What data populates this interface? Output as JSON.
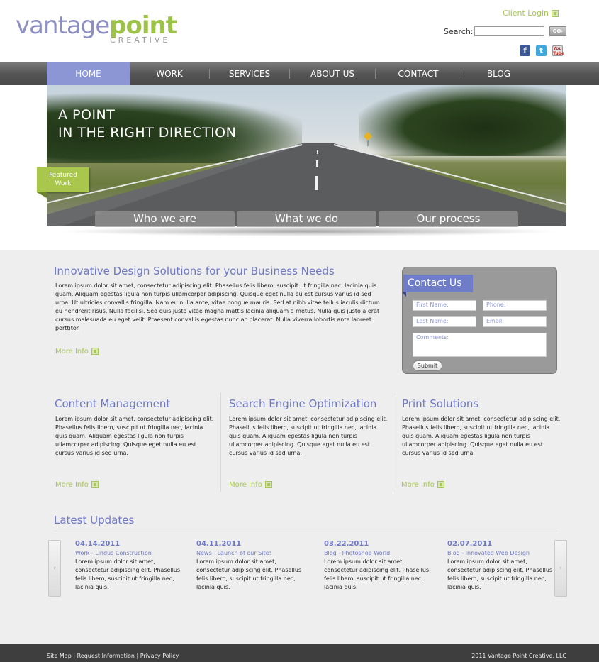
{
  "header": {
    "logo_part1": "vantage",
    "logo_part2": "point",
    "logo_sub": "CREATIVE",
    "client_login": "Client Login",
    "search_label": "Search:",
    "search_value": "",
    "search_button": "GO›",
    "social": [
      "f",
      "t",
      "You Tube"
    ]
  },
  "nav": {
    "items": [
      {
        "label": "HOME",
        "active": true
      },
      {
        "label": "WORK"
      },
      {
        "label": "SERVICES"
      },
      {
        "label": "ABOUT US"
      },
      {
        "label": "CONTACT"
      },
      {
        "label": "BLOG"
      }
    ]
  },
  "hero": {
    "tagline_line1": "A POINT",
    "tagline_line2": "IN THE RIGHT DIRECTION",
    "featured_line1": "Featured",
    "featured_line2": "Work",
    "tabs": [
      "Who we are",
      "What we do",
      "Our process"
    ]
  },
  "intro": {
    "title": "Innovative Design Solutions for your Business Needs",
    "body": "Lorem ipsum dolor sit amet, consectetur adipiscing elit. Phasellus felis libero, suscipit ut fringilla nec, lacinia quis quam. Aliquam egestas ligula non turpis ullamcorper adipiscing. Quisque eget nulla eu est cursus varius id sed urna. Ut ultricies convallis fringilla. Nam eu nulla ante, vitae congue mauris. Sed at nibh vitae tellus iaculis dictum eu hendrerit risus. Nulla facilisi. Sed quis justo vitae magna mattis lacinia aliquam a metus. Nulla quis justo a erat cursus malesuada eu eget velit. Praesent convallis egestas nunc ac placerat. Nulla viverra lobortis ante laoreet porttitor.",
    "more": "More Info"
  },
  "contact": {
    "title": "Contact Us",
    "first_name": "First Name:",
    "phone": "Phone:",
    "last_name": "Last Name:",
    "email": "Email:",
    "comments": "Comments:",
    "submit": "Submit"
  },
  "columns": [
    {
      "title": "Content Management",
      "body": "Lorem ipsum dolor sit amet, consectetur adipiscing elit. Phasellus felis libero, suscipit ut fringilla nec, lacinia quis quam. Aliquam egestas ligula non turpis ullamcorper adipiscing. Quisque eget nulla eu est cursus varius id sed urna.",
      "more": "More Info"
    },
    {
      "title": "Search Engine Optimization",
      "body": "Lorem ipsum dolor sit amet, consectetur adipiscing elit. Phasellus felis libero, suscipit ut fringilla nec, lacinia quis quam. Aliquam egestas ligula non turpis ullamcorper adipiscing. Quisque eget nulla eu est cursus varius id sed urna.",
      "more": "More Info"
    },
    {
      "title": "Print Solutions",
      "body": "Lorem ipsum dolor sit amet, consectetur adipiscing elit. Phasellus felis libero, suscipit ut fringilla nec, lacinia quis quam. Aliquam egestas ligula non turpis ullamcorper adipiscing. Quisque eget nulla eu est cursus varius id sed urna.",
      "more": "More Info"
    }
  ],
  "updates": {
    "title": "Latest Updates",
    "prev": "‹",
    "next": "›",
    "items": [
      {
        "date": "04.14.2011",
        "sub": "Work - Lindus Construction",
        "body": "Lorem ipsum dolor sit amet, consectetur adipiscing elit. Phasellus felis libero, suscipit ut fringilla nec, lacinia quis."
      },
      {
        "date": "04.11.2011",
        "sub": "News - Launch of our Site!",
        "body": "Lorem ipsum dolor sit amet, consectetur adipiscing elit. Phasellus felis libero, suscipit ut fringilla nec, lacinia quis."
      },
      {
        "date": "03.22.2011",
        "sub": "Blog - Photoshop World",
        "body": "Lorem ipsum dolor sit amet, consectetur adipiscing elit. Phasellus felis libero, suscipit ut fringilla nec, lacinia quis."
      },
      {
        "date": "02.07.2011",
        "sub": "Blog - Innovated Web Design",
        "body": "Lorem ipsum dolor sit amet, consectetur adipiscing elit. Phasellus felis libero, suscipit ut fringilla nec, lacinia quis."
      }
    ]
  },
  "footer": {
    "links": "Site Map | Request Information | Privacy Policy",
    "copyright": "2011 Vantage Point Creative, LLC"
  },
  "colors": {
    "brand_purple": "#6f79c4",
    "brand_green": "#9dc24a",
    "nav_active": "#8c96d4"
  },
  "icons": [
    "facebook-icon",
    "twitter-icon",
    "youtube-icon",
    "more-info-icon",
    "arrow-left-icon",
    "arrow-right-icon"
  ]
}
